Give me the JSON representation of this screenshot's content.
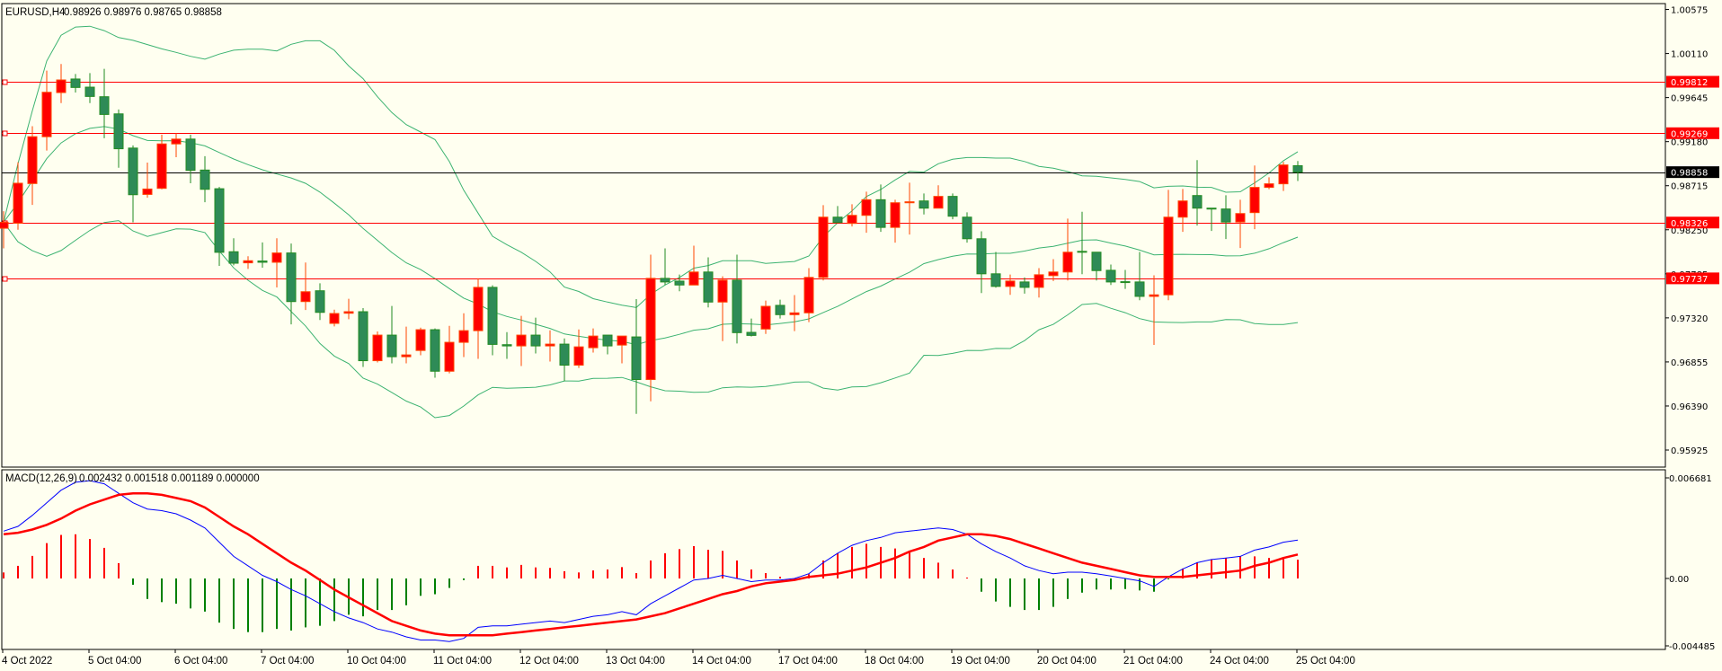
{
  "title": {
    "symbol": "EURUSD,H4",
    "ohlc_text": "0.98926 0.98976 0.98765 0.98858"
  },
  "macd_title": {
    "label": "MACD(12,26,9)",
    "values_text": "0.002432 0.001518 0.001189 0.000000"
  },
  "colors": {
    "background": "#fffff0",
    "bull_body": "#ff0000",
    "bull_edge": "#ff4500",
    "bear_body": "#2e8b57",
    "bear_edge": "#228b22",
    "bands": "#3cb371",
    "level_line": "#ff0000",
    "current_price": "#000000",
    "macd_main": "#0000ff",
    "macd_signal": "#ff0000",
    "hist_pos": "#ff0000",
    "hist_neg": "#008000"
  },
  "chart_data": [
    {
      "type": "candlestick",
      "title": "EURUSD,H4",
      "ylim": [
        0.95745,
        1.00637
      ],
      "y_ticks": [
        "1.00575",
        "1.00110",
        "0.99645",
        "0.99180",
        "0.98715",
        "0.98250",
        "0.97785",
        "0.97320",
        "0.96855",
        "0.96390",
        "0.95925"
      ],
      "x_tick_labels": [
        {
          "bar": 0,
          "label": "4 Oct 2022"
        },
        {
          "bar": 6,
          "label": "5 Oct 04:00"
        },
        {
          "bar": 12,
          "label": "6 Oct 04:00"
        },
        {
          "bar": 18,
          "label": "7 Oct 04:00"
        },
        {
          "bar": 24,
          "label": "10 Oct 04:00"
        },
        {
          "bar": 30,
          "label": "11 Oct 04:00"
        },
        {
          "bar": 36,
          "label": "12 Oct 04:00"
        },
        {
          "bar": 42,
          "label": "13 Oct 04:00"
        },
        {
          "bar": 48,
          "label": "14 Oct 04:00"
        },
        {
          "bar": 54,
          "label": "17 Oct 04:00"
        },
        {
          "bar": 60,
          "label": "18 Oct 04:00"
        },
        {
          "bar": 66,
          "label": "19 Oct 04:00"
        },
        {
          "bar": 72,
          "label": "20 Oct 04:00"
        },
        {
          "bar": 78,
          "label": "21 Oct 04:00"
        },
        {
          "bar": 84,
          "label": "24 Oct 04:00"
        },
        {
          "bar": 90,
          "label": "25 Oct 04:00"
        }
      ],
      "levels": [
        "0.99812",
        "0.99269",
        "0.98326",
        "0.97737"
      ],
      "current_price": "0.98858",
      "ohlc": [
        [
          0.98266,
          0.98446,
          0.98053,
          0.98329
        ],
        [
          0.98319,
          0.98963,
          0.9825,
          0.98741
        ],
        [
          0.98738,
          0.99343,
          0.98512,
          0.99232
        ],
        [
          0.99232,
          0.99929,
          0.99086,
          0.99701
        ],
        [
          0.99698,
          0.99999,
          0.99587,
          0.99831
        ],
        [
          0.99841,
          0.99894,
          0.99698,
          0.99752
        ],
        [
          0.99755,
          0.99904,
          0.99587,
          0.99657
        ],
        [
          0.99654,
          0.99948,
          0.99216,
          0.99467
        ],
        [
          0.99473,
          0.9952,
          0.98905,
          0.99105
        ],
        [
          0.99112,
          0.9914,
          0.98329,
          0.9862
        ],
        [
          0.98623,
          0.98959,
          0.98588,
          0.9868
        ],
        [
          0.98687,
          0.99254,
          0.98677,
          0.99156
        ],
        [
          0.99156,
          0.9927,
          0.99016,
          0.99207
        ],
        [
          0.99207,
          0.99254,
          0.98741,
          0.98877
        ],
        [
          0.9888,
          0.99026,
          0.98541,
          0.98677
        ],
        [
          0.98683,
          0.98702,
          0.97869,
          0.98012
        ],
        [
          0.98018,
          0.9816,
          0.97875,
          0.97897
        ],
        [
          0.97901,
          0.9797,
          0.97837,
          0.97923
        ],
        [
          0.9792,
          0.98116,
          0.9785,
          0.97907
        ],
        [
          0.97907,
          0.9816,
          0.97641,
          0.98005
        ],
        [
          0.98005,
          0.98104,
          0.97251,
          0.97492
        ],
        [
          0.97492,
          0.97904,
          0.97403,
          0.97596
        ],
        [
          0.97606,
          0.97685,
          0.97298,
          0.97378
        ],
        [
          0.97262,
          0.97407,
          0.9723,
          0.97366
        ],
        [
          0.97369,
          0.97521,
          0.97306,
          0.97385
        ],
        [
          0.97385,
          0.97423,
          0.96802,
          0.96868
        ],
        [
          0.96868,
          0.97176,
          0.96849,
          0.97138
        ],
        [
          0.97138,
          0.97445,
          0.9684,
          0.9691
        ],
        [
          0.9691,
          0.97227,
          0.9684,
          0.96929
        ],
        [
          0.96976,
          0.97217,
          0.96925,
          0.97195
        ],
        [
          0.97195,
          0.97208,
          0.96688,
          0.96757
        ],
        [
          0.96757,
          0.97236,
          0.96735,
          0.97062
        ],
        [
          0.97062,
          0.97369,
          0.96906,
          0.97185
        ],
        [
          0.97185,
          0.97737,
          0.96887,
          0.97642
        ],
        [
          0.97642,
          0.97664,
          0.96925,
          0.9704
        ],
        [
          0.97037,
          0.9717,
          0.96887,
          0.97024
        ],
        [
          0.97024,
          0.97341,
          0.96811,
          0.97138
        ],
        [
          0.97138,
          0.97322,
          0.96944,
          0.97024
        ],
        [
          0.97024,
          0.97189,
          0.96859,
          0.97043
        ],
        [
          0.97043,
          0.97103,
          0.96653,
          0.96821
        ],
        [
          0.96821,
          0.97198,
          0.96792,
          0.97014
        ],
        [
          0.97005,
          0.97208,
          0.96954,
          0.97128
        ],
        [
          0.97138,
          0.97138,
          0.96935,
          0.97024
        ],
        [
          0.97033,
          0.97128,
          0.9684,
          0.97128
        ],
        [
          0.97119,
          0.97518,
          0.96307,
          0.96669
        ],
        [
          0.96669,
          0.97987,
          0.9644,
          0.97737
        ],
        [
          0.97737,
          0.98054,
          0.97667,
          0.97699
        ],
        [
          0.97708,
          0.97778,
          0.97601,
          0.97667
        ],
        [
          0.97667,
          0.98082,
          0.97667,
          0.97804
        ],
        [
          0.97804,
          0.97959,
          0.9743,
          0.97487
        ],
        [
          0.97487,
          0.97759,
          0.97075,
          0.97718
        ],
        [
          0.97718,
          0.97987,
          0.9705,
          0.97164
        ],
        [
          0.97167,
          0.97313,
          0.97123,
          0.97135
        ],
        [
          0.97202,
          0.97503,
          0.97151,
          0.97442
        ],
        [
          0.97452,
          0.97512,
          0.97313,
          0.97354
        ],
        [
          0.97354,
          0.9756,
          0.9718,
          0.97373
        ],
        [
          0.97373,
          0.97845,
          0.97275,
          0.97747
        ],
        [
          0.97747,
          0.9851,
          0.97715,
          0.98383
        ],
        [
          0.98383,
          0.985,
          0.98326,
          0.98326
        ],
        [
          0.98317,
          0.98519,
          0.98285,
          0.98402
        ],
        [
          0.98402,
          0.98652,
          0.98218,
          0.98567
        ],
        [
          0.98567,
          0.98728,
          0.98228,
          0.98275
        ],
        [
          0.98275,
          0.98567,
          0.98114,
          0.98535
        ],
        [
          0.98535,
          0.98747,
          0.98199,
          0.98545
        ],
        [
          0.98554,
          0.98633,
          0.98412,
          0.98478
        ],
        [
          0.98478,
          0.98719,
          0.98478,
          0.98602
        ],
        [
          0.98602,
          0.98633,
          0.98361,
          0.98393
        ],
        [
          0.98383,
          0.98434,
          0.98114,
          0.98155
        ],
        [
          0.98155,
          0.98234,
          0.97582,
          0.97785
        ],
        [
          0.97785,
          0.98016,
          0.97639,
          0.97652
        ],
        [
          0.97652,
          0.97778,
          0.97563,
          0.97709
        ],
        [
          0.97699,
          0.97747,
          0.97576,
          0.97642
        ],
        [
          0.97642,
          0.97845,
          0.97534,
          0.97775
        ],
        [
          0.97766,
          0.9794,
          0.97709,
          0.97804
        ],
        [
          0.97804,
          0.98367,
          0.97715,
          0.98013
        ],
        [
          0.98022,
          0.9844,
          0.97781,
          0.98013
        ],
        [
          0.98013,
          0.98013,
          0.97715,
          0.97819
        ],
        [
          0.97822,
          0.97883,
          0.97667,
          0.97699
        ],
        [
          0.97702,
          0.97826,
          0.97626,
          0.97696
        ],
        [
          0.97699,
          0.98016,
          0.97506,
          0.97547
        ],
        [
          0.97547,
          0.97769,
          0.97034,
          0.97563
        ],
        [
          0.97563,
          0.98671,
          0.97506,
          0.98383
        ],
        [
          0.98383,
          0.98681,
          0.98228,
          0.98554
        ],
        [
          0.98611,
          0.98985,
          0.98294,
          0.98478
        ],
        [
          0.98478,
          0.98478,
          0.98237,
          0.98469
        ],
        [
          0.98469,
          0.98614,
          0.98152,
          0.98332
        ],
        [
          0.98332,
          0.98567,
          0.98057,
          0.98421
        ],
        [
          0.98431,
          0.98928,
          0.98256,
          0.98697
        ],
        [
          0.98697,
          0.98804,
          0.98678,
          0.98735
        ],
        [
          0.98735,
          0.98966,
          0.98659,
          0.98934
        ],
        [
          0.98926,
          0.98976,
          0.98765,
          0.98858
        ]
      ]
    },
    {
      "type": "line",
      "title": "MACD(12,26,9)",
      "ylim": [
        -0.0045,
        0.00689
      ],
      "y_ticks": [
        "0.006681",
        "0.00",
        "-0.004485"
      ],
      "series": [
        {
          "name": "main",
          "values": [
            0.003,
            0.0033,
            0.004,
            0.0048,
            0.0056,
            0.0061,
            0.0062,
            0.006,
            0.0054,
            0.0048,
            0.0044,
            0.0043,
            0.0041,
            0.0037,
            0.0032,
            0.0023,
            0.0014,
            0.0008,
            0.0002,
            -0.0002,
            -0.0007,
            -0.0011,
            -0.0016,
            -0.0021,
            -0.0025,
            -0.0028,
            -0.0032,
            -0.0034,
            -0.0037,
            -0.0039,
            -0.0039,
            -0.004,
            -0.0038,
            -0.0031,
            -0.003,
            -0.003,
            -0.0029,
            -0.0028,
            -0.0027,
            -0.0028,
            -0.0026,
            -0.0024,
            -0.0023,
            -0.0021,
            -0.0023,
            -0.0016,
            -0.0011,
            -0.0006,
            -0.0001,
            0,
            0.0002,
            0,
            -0.0002,
            -0.0001,
            -0.0001,
            0,
            0.0003,
            0.001,
            0.0016,
            0.0021,
            0.0024,
            0.0026,
            0.0029,
            0.003,
            0.0031,
            0.0032,
            0.0031,
            0.0028,
            0.0022,
            0.0017,
            0.0013,
            0.0008,
            0.0005,
            0.0003,
            0.0004,
            0.0004,
            0.0003,
            0.00015,
            0,
            -0.00015,
            -0.0005,
            0.0001,
            0.0006,
            0.001,
            0.0012,
            0.0013,
            0.0014,
            0.0018,
            0.002,
            0.0023,
            0.002432
          ]
        },
        {
          "name": "signal",
          "values": [
            0.0028,
            0.0029,
            0.0031,
            0.0034,
            0.0038,
            0.0043,
            0.0047,
            0.005,
            0.0053,
            0.0054,
            0.0054,
            0.0053,
            0.0051,
            0.0049,
            0.0045,
            0.0039,
            0.0033,
            0.0028,
            0.0022,
            0.0016,
            0.001,
            0.0005,
            -0.0001,
            -0.0007,
            -0.0012,
            -0.0017,
            -0.0022,
            -0.0027,
            -0.003,
            -0.0033,
            -0.0035,
            -0.0036,
            -0.0036,
            -0.0036,
            -0.0036,
            -0.0035,
            -0.0034,
            -0.0033,
            -0.0032,
            -0.0031,
            -0.003,
            -0.0029,
            -0.0028,
            -0.0027,
            -0.0026,
            -0.0024,
            -0.0022,
            -0.0019,
            -0.0016,
            -0.0013,
            -0.001,
            -0.0008,
            -0.0005,
            -0.0003,
            -0.0002,
            -0.0001,
            0.0001,
            0.0002,
            0.0003,
            0.0005,
            0.0007,
            0.001,
            0.0013,
            0.0017,
            0.002,
            0.0024,
            0.0026,
            0.0028,
            0.0028,
            0.0027,
            0.0025,
            0.0022,
            0.0019,
            0.0016,
            0.0013,
            0.001,
            0.0008,
            0.0006,
            0.0004,
            0.0002,
            0.0001,
            0.0001,
            0.0001,
            0.0002,
            0.0003,
            0.0004,
            0.0005,
            0.0008,
            0.001,
            0.0013,
            0.001518
          ]
        },
        {
          "name": "histogram",
          "values": [
            0.00038,
            0.0008,
            0.00143,
            0.00224,
            0.00276,
            0.0028,
            0.0025,
            0.00194,
            0.00097,
            -0.0004,
            -0.0013,
            -0.0015,
            -0.0016,
            -0.0019,
            -0.0021,
            -0.0028,
            -0.0032,
            -0.0034,
            -0.0034,
            -0.0032,
            -0.0033,
            -0.0031,
            -0.003,
            -0.0027,
            -0.0023,
            -0.0024,
            -0.002,
            -0.002,
            -0.0017,
            -0.0011,
            -0.001,
            -0.0006,
            -0.0001,
            0.0008,
            0.0008,
            0.0007,
            0.00086,
            0.0007,
            0.00067,
            0.00046,
            0.00038,
            0.00051,
            0.00057,
            0.00072,
            0.00034,
            0.00114,
            0.0016,
            0.00186,
            0.00205,
            0.00182,
            0.00175,
            0.00114,
            0.00057,
            0.00034,
            0.00011,
            -1e-05,
            0.00027,
            0.00114,
            0.0016,
            0.002,
            0.0022,
            0.002,
            0.0019,
            0.0017,
            0.0013,
            0.001,
            0.00057,
            3e-05,
            -0.00084,
            -0.00146,
            -0.0018,
            -0.002,
            -0.002,
            -0.0018,
            -0.0013,
            -0.0009,
            -0.0007,
            -0.0007,
            -0.00067,
            -0.00076,
            -0.00084,
            -5e-05,
            0.00063,
            0.001,
            0.0012,
            0.0013,
            0.0014,
            0.0014,
            0.0013,
            0.0013,
            0.001189
          ]
        }
      ]
    }
  ]
}
